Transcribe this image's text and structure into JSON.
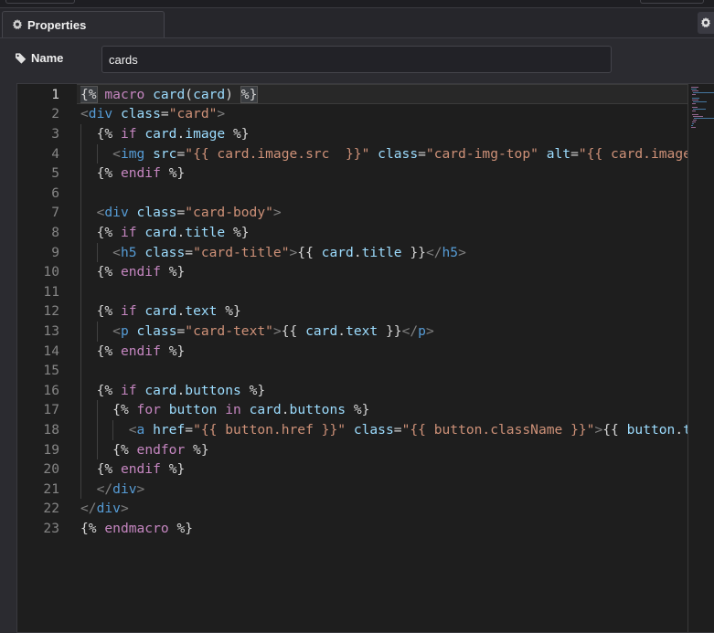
{
  "panel": {
    "tab_label": "Properties",
    "tab_icon": "gear-icon",
    "settings_icon": "gear-icon"
  },
  "name_field": {
    "label": "Name",
    "label_icon": "tag-icon",
    "value": "cards"
  },
  "editor": {
    "language": "nunjucks",
    "current_line": 1,
    "lines": [
      "{% macro card(card) %}",
      "<div class=\"card\">",
      "  {% if card.image %}",
      "    <img src=\"{{ card.image.src  }}\" class=\"card-img-top\" alt=\"{{ card.image.alt }}\">",
      "  {% endif %}",
      "",
      "  <div class=\"card-body\">",
      "  {% if card.title %}",
      "    <h5 class=\"card-title\">{{ card.title }}</h5>",
      "  {% endif %}",
      "",
      "  {% if card.text %}",
      "    <p class=\"card-text\">{{ card.text }}</p>",
      "  {% endif %}",
      "",
      "  {% if card.buttons %}",
      "    {% for button in card.buttons %}",
      "      <a href=\"{{ button.href }}\" class=\"{{ button.className }}\">{{ button.text }}</a>",
      "    {% endfor %}",
      "  {% endif %}",
      "  </div>",
      "</div>",
      "{% endmacro %}"
    ]
  },
  "colors": {
    "background": "#2b2b30",
    "editor_bg": "#1e1e1e",
    "keyword": "#c586c0",
    "html_tag": "#569cd6",
    "attribute": "#9cdcfe",
    "string": "#ce9178"
  }
}
